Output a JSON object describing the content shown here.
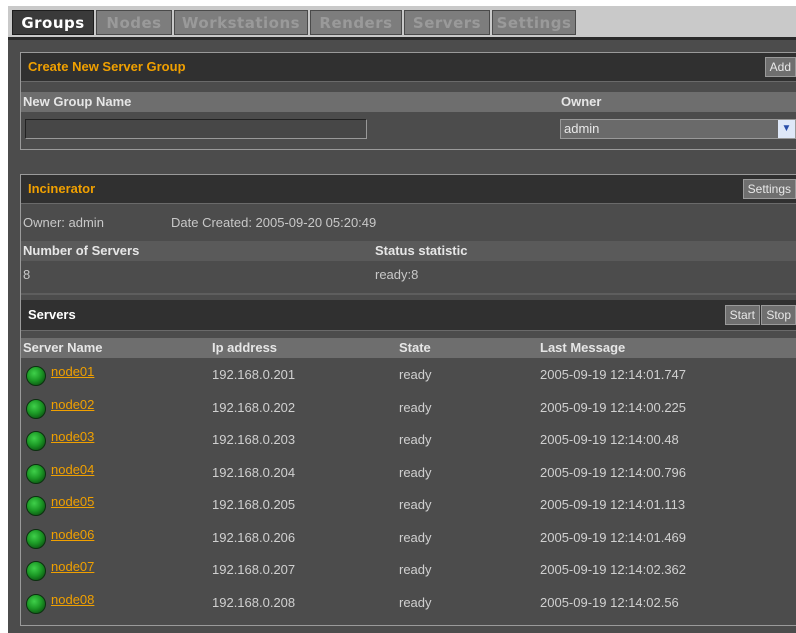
{
  "tabs": [
    {
      "label": "Groups"
    },
    {
      "label": "Nodes"
    },
    {
      "label": "Workstations"
    },
    {
      "label": "Renders"
    },
    {
      "label": "Servers"
    },
    {
      "label": "Settings"
    }
  ],
  "create_group": {
    "title": "Create New Server Group",
    "add_label": "Add",
    "name_header": "New Group Name",
    "owner_header": "Owner",
    "name_value": "",
    "owner_value": "admin"
  },
  "group": {
    "title": "Incinerator",
    "settings_label": "Settings",
    "owner_text": "Owner: admin",
    "date_text": "Date Created: 2005-09-20 05:20:49",
    "num_servers_header": "Number of Servers",
    "status_header": "Status statistic",
    "num_servers": "8",
    "status_value": "ready:8"
  },
  "servers": {
    "title": "Servers",
    "start_label": "Start",
    "stop_label": "Stop",
    "columns": [
      "Server Name",
      "Ip address",
      "State",
      "Last Message"
    ],
    "rows": [
      {
        "name": "node01",
        "ip": "192.168.0.201",
        "state": "ready",
        "msg": "2005-09-19 12:14:01.747"
      },
      {
        "name": "node02",
        "ip": "192.168.0.202",
        "state": "ready",
        "msg": "2005-09-19 12:14:00.225"
      },
      {
        "name": "node03",
        "ip": "192.168.0.203",
        "state": "ready",
        "msg": "2005-09-19 12:14:00.48"
      },
      {
        "name": "node04",
        "ip": "192.168.0.204",
        "state": "ready",
        "msg": "2005-09-19 12:14:00.796"
      },
      {
        "name": "node05",
        "ip": "192.168.0.205",
        "state": "ready",
        "msg": "2005-09-19 12:14:01.113"
      },
      {
        "name": "node06",
        "ip": "192.168.0.206",
        "state": "ready",
        "msg": "2005-09-19 12:14:01.469"
      },
      {
        "name": "node07",
        "ip": "192.168.0.207",
        "state": "ready",
        "msg": "2005-09-19 12:14:02.362"
      },
      {
        "name": "node08",
        "ip": "192.168.0.208",
        "state": "ready",
        "msg": "2005-09-19 12:14:02.56"
      }
    ]
  }
}
